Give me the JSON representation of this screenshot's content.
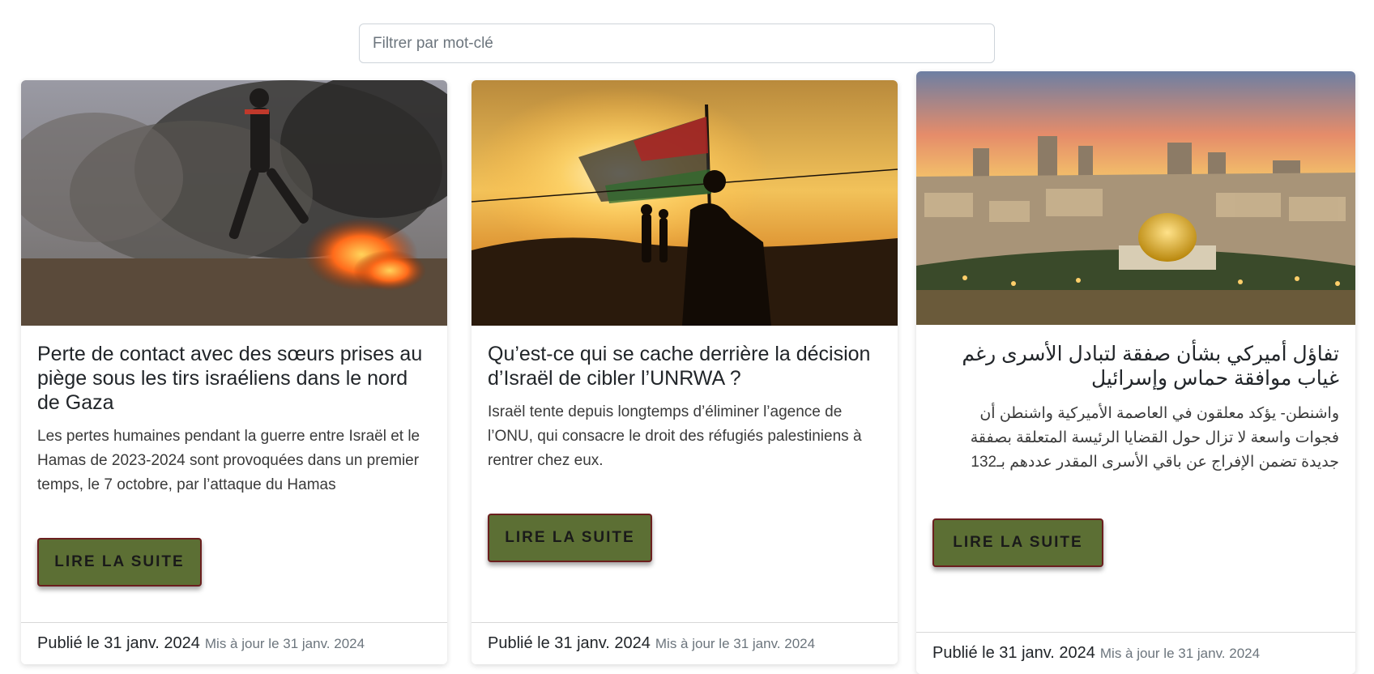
{
  "search": {
    "placeholder": "Filtrer par mot-clé"
  },
  "cards": [
    {
      "title": "Perte de contact avec des sœurs prises au piège sous les tirs israéliens dans le nord de Gaza",
      "text": "Les pertes humaines pendant la guerre entre Israël et le Hamas de 2023-2024 sont provoquées dans un premier temps, le 7 octobre, par l’attaque du Hamas",
      "button": "Lire la suite",
      "published": "Publié le 31 janv. 2024",
      "updated": "Mis à jour le 31 janv. 2024"
    },
    {
      "title": "Qu’est-ce qui se cache derrière la décision d’Israël de cibler l’UNRWA ?",
      "text": "Israël tente depuis longtemps d’éliminer l’agence de l’ONU, qui consacre le droit des réfugiés palestiniens à rentrer chez eux.",
      "button": "Lire la suite",
      "published": "Publié le 31 janv. 2024",
      "updated": "Mis à jour le 31 janv. 2024"
    },
    {
      "title": "تفاؤل أميركي بشأن صفقة لتبادل الأسرى رغم غياب موافقة حماس وإسرائيل",
      "text": "واشنطن- يؤكد معلقون في العاصمة الأميركية واشنطن أن فجوات واسعة لا تزال حول القضايا الرئيسة المتعلقة بصفقة جديدة تضمن الإفراج عن باقي الأسرى المقدر عددهم بـ132",
      "button": "Lire la suite",
      "published": "Publié le 31 janv. 2024",
      "updated": "Mis à jour le 31 janv. 2024"
    }
  ]
}
